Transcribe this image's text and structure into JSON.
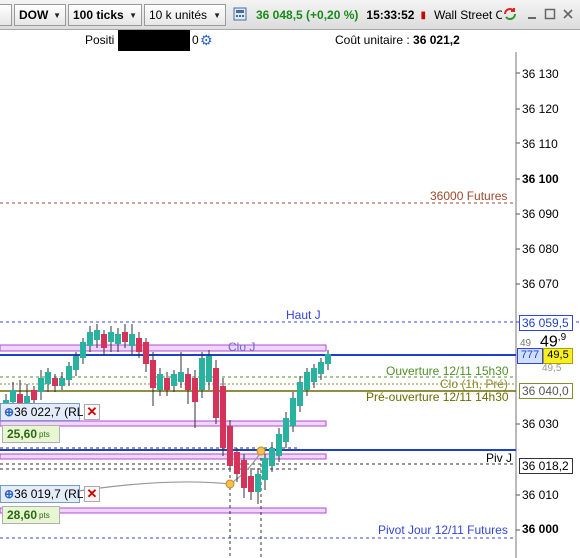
{
  "toolbar": {
    "instrument_select": "DOW",
    "ticks_select": "100 ticks",
    "units_select": "10 k unités",
    "last_price": "36 048,5 (+0,20 %)",
    "time": "15:33:52",
    "instrument_name": "Wall Street C"
  },
  "infobar": {
    "position_label": "Positi",
    "position_value": "0",
    "cost_label": "Coût unitaire : ",
    "cost_value": "36 021,2"
  },
  "axis": {
    "ticks": [
      "36 130",
      "36 120",
      "36 110",
      "36 100",
      "36 090",
      "36 080",
      "36 070",
      "36 030",
      "36 010",
      "36 000"
    ],
    "tags": {
      "haut": "36 059,5",
      "current_small": "49",
      "current_big": "49",
      "current_sup": ",9",
      "bid_left": "777",
      "bid_right": "49,5",
      "below": "49,5",
      "clo": "36 040,0",
      "piv": "36 018,2"
    }
  },
  "levels": {
    "futures": "36000 Futures",
    "haut_j": "Haut J",
    "clo_j": "Clo J",
    "ouverture": "Ouverture 12/11 15h30",
    "clo_1h": "Clo (1h, Pré)",
    "pre_ouverture": "Pré-ouverture 12/11 14h30",
    "piv_j": "Piv J",
    "pivot_jour": "Pivot Jour 12/11 Futures"
  },
  "orders": [
    {
      "price": "36 022,7 (RL)",
      "points_value": "25,60",
      "points_unit": "pts"
    },
    {
      "price": "36 019,7 (RL)",
      "points_value": "28,60",
      "points_unit": "pts"
    }
  ],
  "colors": {
    "up": "#27b3a0",
    "down": "#d6335a",
    "price_line": "#1f3fc8",
    "haut_line": "#3344dd",
    "futures_line": "#9b4a2c",
    "green_dash": "#4f8f2a",
    "olive_line": "#6b6b00",
    "band": "#b04bd8"
  }
}
